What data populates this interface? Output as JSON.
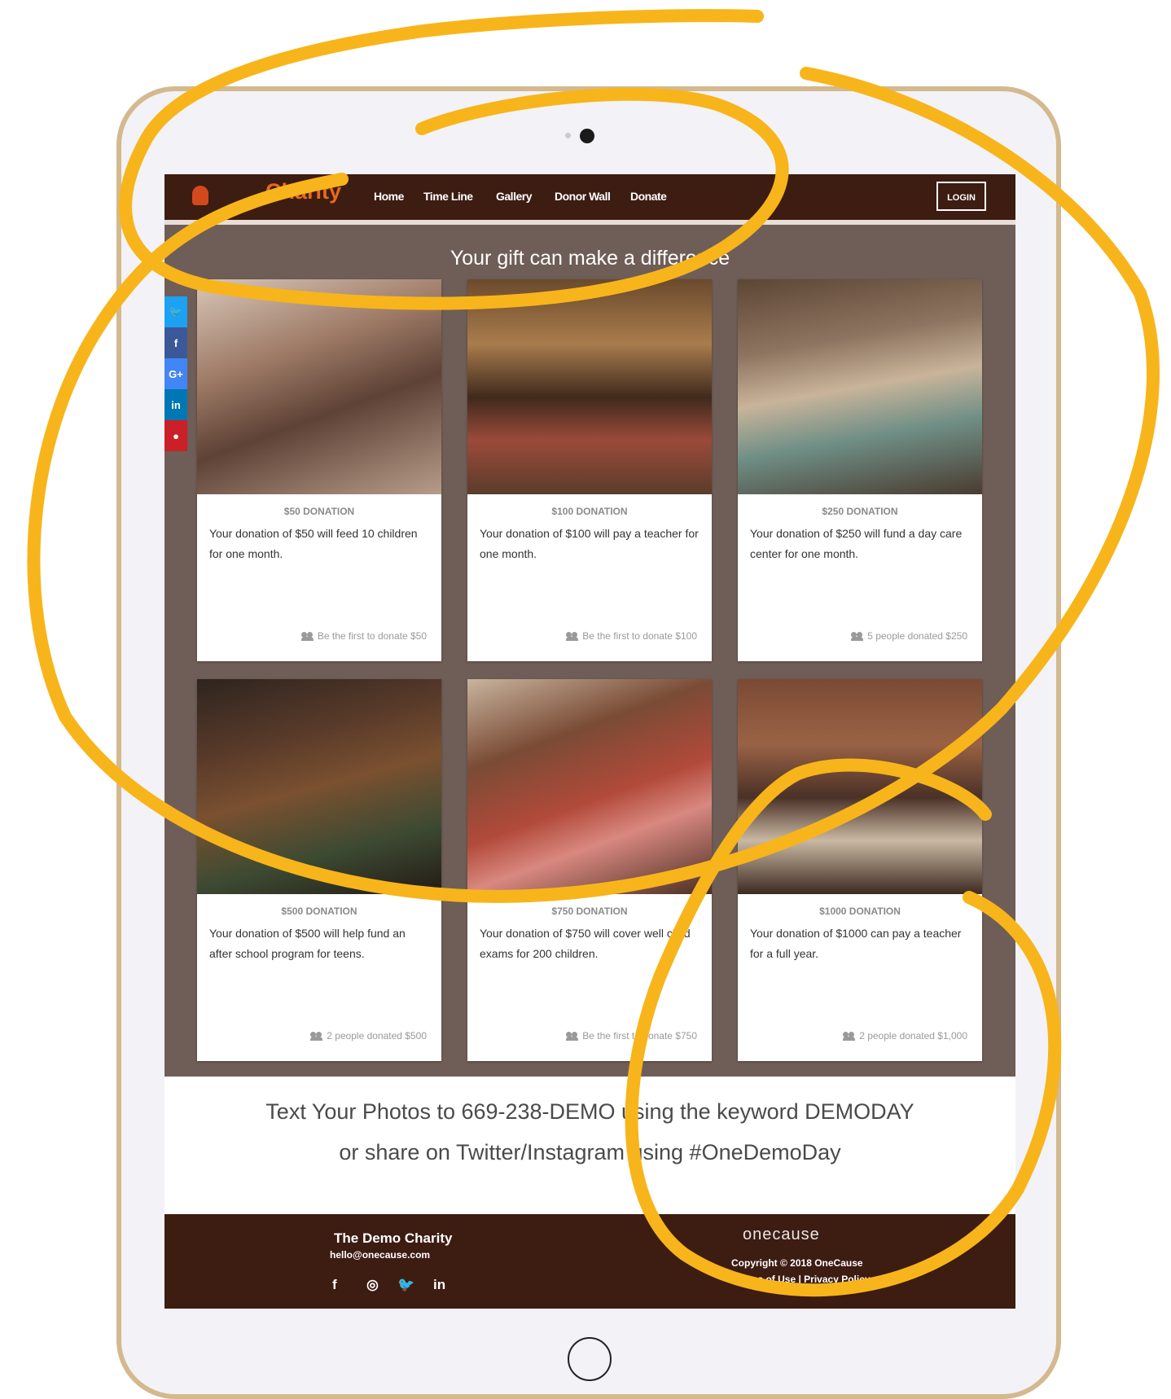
{
  "nav": {
    "brand": "Charity",
    "links": [
      "Home",
      "Time Line",
      "Gallery",
      "Donor Wall",
      "Donate"
    ],
    "login": "LOGIN"
  },
  "main": {
    "headline": "Your gift can make a difference",
    "social": [
      {
        "icon": "twitter-icon",
        "glyph": "🐦",
        "color": "#1da1f2"
      },
      {
        "icon": "facebook-icon",
        "glyph": "f",
        "color": "#3b5998"
      },
      {
        "icon": "google-plus-icon",
        "glyph": "G+",
        "color": "#4285f4"
      },
      {
        "icon": "linkedin-icon",
        "glyph": "in",
        "color": "#0077b5"
      },
      {
        "icon": "pinterest-icon",
        "glyph": "●",
        "color": "#cb2027"
      }
    ],
    "cards": [
      {
        "title": "$50 DONATION",
        "text": "Your donation of $50 will feed 10 children for one month.",
        "footer": "Be the first to donate $50"
      },
      {
        "title": "$100 DONATION",
        "text": "Your donation of $100 will pay a teacher for one month.",
        "footer": "Be the first to donate $100"
      },
      {
        "title": "$250 DONATION",
        "text": "Your donation of $250 will fund a day care center for one month.",
        "footer": "5 people donated $250"
      },
      {
        "title": "$500 DONATION",
        "text": "Your donation of $500 will help fund an after school program for teens.",
        "footer": "2 people donated $500"
      },
      {
        "title": "$750 DONATION",
        "text": "Your donation of $750 will cover well child exams for 200 children.",
        "footer": "Be the first to donate $750"
      },
      {
        "title": "$1000 DONATION",
        "text": "Your donation of $1000 can pay a teacher for a full year.",
        "footer": "2 people donated $1,000"
      }
    ]
  },
  "photos": {
    "line1": "Text Your Photos to 669-238-DEMO using the keyword DEMODAY",
    "line2": "or share on Twitter/Instagram using #OneDemoDay"
  },
  "footer": {
    "org_name": "The Demo Charity",
    "email": "hello@onecause.com",
    "social": [
      "f",
      "◎",
      "🐦",
      "in"
    ],
    "brand": "onecause",
    "copyright": "Copyright © 2018 OneCause",
    "links": "Terms of Use | Privacy Policy"
  },
  "colors": {
    "nav_bg": "#3d1c12",
    "brand": "#e46a1f",
    "gallery_bg": "#6f5e57",
    "annotation": "#f7b51b"
  }
}
